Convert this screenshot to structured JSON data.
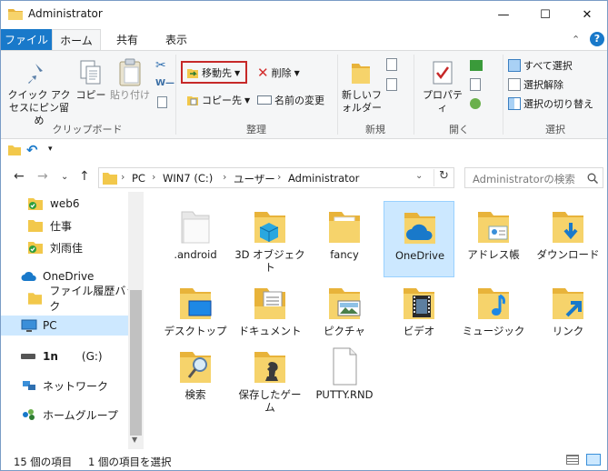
{
  "window": {
    "title": "Administrator",
    "minimize": "—",
    "maximize": "☐",
    "close": "✕"
  },
  "tabs": {
    "file": "ファイル",
    "home": "ホーム",
    "share": "共有",
    "view": "表示"
  },
  "ribbon": {
    "clipboard": {
      "pin_label": "クイック アクセスにピン留め",
      "copy_label": "コピー",
      "paste_label": "貼り付け",
      "group_label": "クリップボード"
    },
    "organize": {
      "move_to": "移動先",
      "copy_to": "コピー先",
      "delete": "削除",
      "rename": "名前の変更",
      "group_label": "整理"
    },
    "new": {
      "new_folder": "新しいフォルダー",
      "group_label": "新規"
    },
    "open": {
      "properties": "プロパティ",
      "group_label": "開く"
    },
    "select": {
      "select_all": "すべて選択",
      "select_none": "選択解除",
      "invert": "選択の切り替え",
      "group_label": "選択"
    }
  },
  "address": {
    "crumbs": [
      "PC",
      "WIN7 (C:)",
      "ユーザー",
      "Administrator"
    ],
    "search_placeholder": "Administratorの検索"
  },
  "nav_pane": {
    "items": [
      {
        "label": "web6",
        "icon": "folder-check-icon"
      },
      {
        "label": "仕事",
        "icon": "folder-icon"
      },
      {
        "label": "刘雨佳",
        "icon": "folder-check-icon"
      },
      {
        "label": "OneDrive",
        "icon": "cloud-icon"
      },
      {
        "label": "ファイル履歴バック",
        "icon": "folder-icon"
      },
      {
        "label": "PC",
        "icon": "pc-icon"
      },
      {
        "label": "1n",
        "icon": "drive-icon"
      },
      {
        "label": "(G:)",
        "icon": "drive-icon"
      },
      {
        "label": "ネットワーク",
        "icon": "network-icon"
      },
      {
        "label": "ホームグループ",
        "icon": "homegroup-icon"
      }
    ]
  },
  "files": [
    {
      "label": ".android",
      "icon": "folder-white-icon"
    },
    {
      "label": "3D オブジェクト",
      "icon": "folder-3d-icon"
    },
    {
      "label": "fancy",
      "icon": "folder-icon"
    },
    {
      "label": "OneDrive",
      "icon": "folder-cloud-icon"
    },
    {
      "label": "アドレス帳",
      "icon": "folder-contacts-icon"
    },
    {
      "label": "ダウンロード",
      "icon": "folder-download-icon"
    },
    {
      "label": "デスクトップ",
      "icon": "folder-desktop-icon"
    },
    {
      "label": "ドキュメント",
      "icon": "folder-documents-icon"
    },
    {
      "label": "ピクチャ",
      "icon": "folder-pictures-icon"
    },
    {
      "label": "ビデオ",
      "icon": "folder-video-icon"
    },
    {
      "label": "ミュージック",
      "icon": "folder-music-icon"
    },
    {
      "label": "リンク",
      "icon": "folder-links-icon"
    },
    {
      "label": "検索",
      "icon": "folder-search-icon"
    },
    {
      "label": "保存したゲーム",
      "icon": "folder-games-icon"
    },
    {
      "label": "PUTTY.RND",
      "icon": "file-icon"
    }
  ],
  "status": {
    "count": "15 個の項目",
    "selected": "1 個の項目を選択"
  },
  "colors": {
    "accent": "#1979ca",
    "folder": "#f2c84b",
    "selection": "#cce8ff",
    "highlight_box": "#c62828"
  }
}
